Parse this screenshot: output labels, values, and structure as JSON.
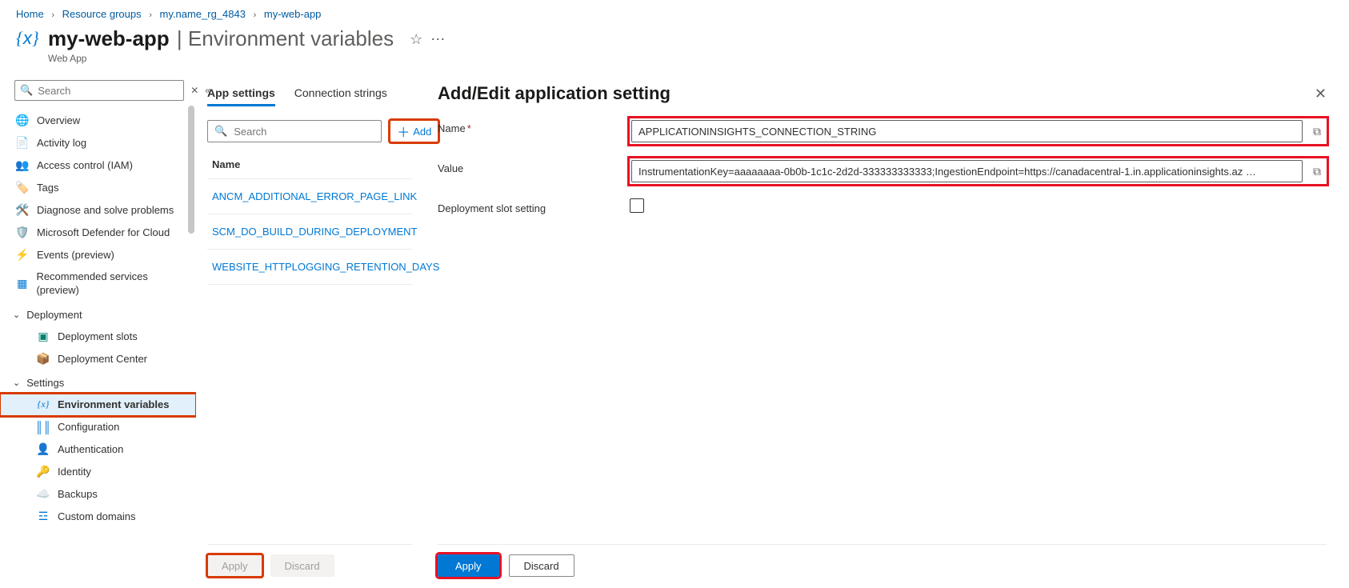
{
  "breadcrumb": [
    {
      "label": "Home"
    },
    {
      "label": "Resource groups"
    },
    {
      "label": "my.name_rg_4843"
    },
    {
      "label": "my-web-app"
    }
  ],
  "header": {
    "title": "my-web-app",
    "section": "| Environment variables",
    "subtitle": "Web App"
  },
  "sidebar": {
    "search_placeholder": "Search",
    "items": [
      {
        "label": "Overview"
      },
      {
        "label": "Activity log"
      },
      {
        "label": "Access control (IAM)"
      },
      {
        "label": "Tags"
      },
      {
        "label": "Diagnose and solve problems"
      },
      {
        "label": "Microsoft Defender for Cloud"
      },
      {
        "label": "Events (preview)"
      },
      {
        "label": "Recommended services (preview)"
      }
    ],
    "groups": [
      {
        "label": "Deployment",
        "children": [
          {
            "label": "Deployment slots"
          },
          {
            "label": "Deployment Center"
          }
        ]
      },
      {
        "label": "Settings",
        "children": [
          {
            "label": "Environment variables",
            "selected": true
          },
          {
            "label": "Configuration"
          },
          {
            "label": "Authentication"
          },
          {
            "label": "Identity"
          },
          {
            "label": "Backups"
          },
          {
            "label": "Custom domains"
          }
        ]
      }
    ]
  },
  "middle": {
    "tabs": [
      {
        "label": "App settings",
        "active": true
      },
      {
        "label": "Connection strings"
      }
    ],
    "search_placeholder": "Search",
    "add_label": "Add",
    "col_name": "Name",
    "settings": [
      {
        "name": "ANCM_ADDITIONAL_ERROR_PAGE_LINK"
      },
      {
        "name": "SCM_DO_BUILD_DURING_DEPLOYMENT"
      },
      {
        "name": "WEBSITE_HTTPLOGGING_RETENTION_DAYS"
      }
    ],
    "footer": {
      "apply": "Apply",
      "discard": "Discard"
    }
  },
  "rpanel": {
    "title": "Add/Edit application setting",
    "labels": {
      "name": "Name",
      "value": "Value",
      "slot": "Deployment slot setting"
    },
    "fields": {
      "name": "APPLICATIONINSIGHTS_CONNECTION_STRING",
      "value": "InstrumentationKey=aaaaaaaa-0b0b-1c1c-2d2d-333333333333;IngestionEndpoint=https://canadacentral-1.in.applicationinsights.az …"
    },
    "footer": {
      "apply": "Apply",
      "discard": "Discard"
    }
  }
}
